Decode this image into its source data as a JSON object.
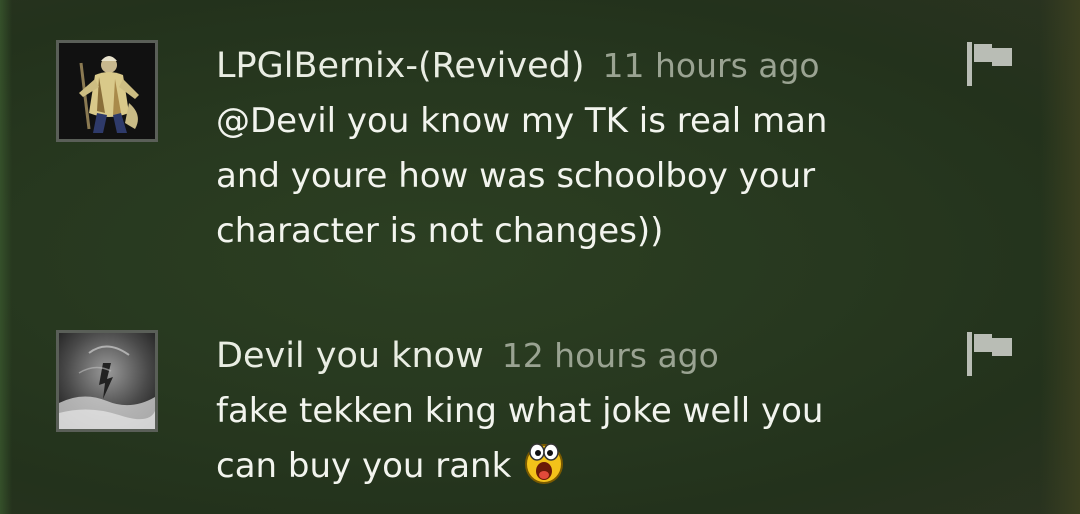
{
  "comments": [
    {
      "author": "LPGlBernix-(Revived)",
      "timestamp": "11 hours ago",
      "body": "@Devil you know my TK is real man\nand youre how was schoolboy your\ncharacter is not changes))",
      "avatar_icon": "robed-warrior-avatar",
      "flag_icon": "flag-icon"
    },
    {
      "author": "Devil you know",
      "timestamp": "12 hours ago",
      "body": "fake tekken king what joke well you\ncan buy you rank",
      "avatar_icon": "storm-figure-avatar",
      "flag_icon": "flag-icon",
      "emoticon": "surprised-yellow-emoticon"
    }
  ],
  "colors": {
    "author": "#e9ede3",
    "timestamp": "#9aa392",
    "body": "#f2f4ee",
    "flag": "#b9bdb5",
    "avatar_border": "#5a5f58",
    "background": "#27381f"
  }
}
